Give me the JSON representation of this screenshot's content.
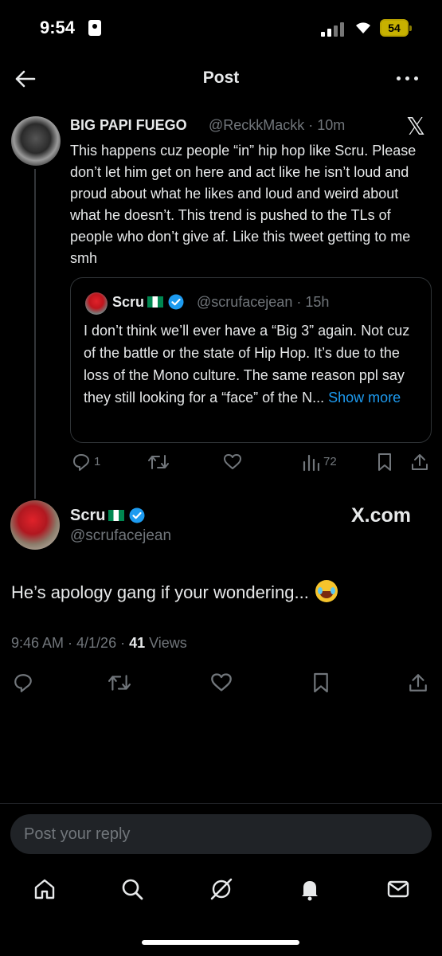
{
  "status_bar": {
    "time": "9:54",
    "battery": "54"
  },
  "header": {
    "title": "Post"
  },
  "reply_tweet": {
    "name": "BIG PAPI FUEGO",
    "handle_time": "@ReckkMackk · 10m",
    "body": "This happens cuz  people “in” hip hop like Scru. Please don’t let him get on here and act like he isn’t loud and proud about what he likes and loud and weird about what he doesn’t. This trend is pushed to the TLs of people who don’t give af. Like this tweet getting to me smh",
    "quote": {
      "name": "Scru",
      "handle_time": "@scrufacejean · 15h",
      "body": "I don’t think we’ll ever have a “Big 3” again. Not cuz of the battle or the state of Hip Hop. It’s due to the loss of the Mono culture. The same reason ppl say they still looking for a “face” of the N...",
      "show_more": "Show more"
    },
    "replies_count": "1",
    "views_count": "72"
  },
  "main_tweet": {
    "name": "Scru",
    "handle": "@scrufacejean",
    "watermark": "X.com",
    "body": "He’s apology gang if your wondering...",
    "time_date": "9:46 AM · 4/1/26 · ",
    "views_count": "41",
    "views_label": " Views"
  },
  "reply_input": {
    "placeholder": "Post your reply"
  },
  "colors": {
    "accent": "#1d9bf0",
    "muted": "#71767b",
    "text": "#e7e9ea",
    "background": "#000000"
  },
  "icons": [
    "back-arrow-icon",
    "more-icon",
    "x-logo-icon",
    "verified-badge-icon",
    "reply-icon",
    "repost-icon",
    "like-icon",
    "views-icon",
    "bookmark-icon",
    "share-icon",
    "home-icon",
    "search-icon",
    "grok-icon",
    "notifications-icon",
    "messages-icon"
  ]
}
